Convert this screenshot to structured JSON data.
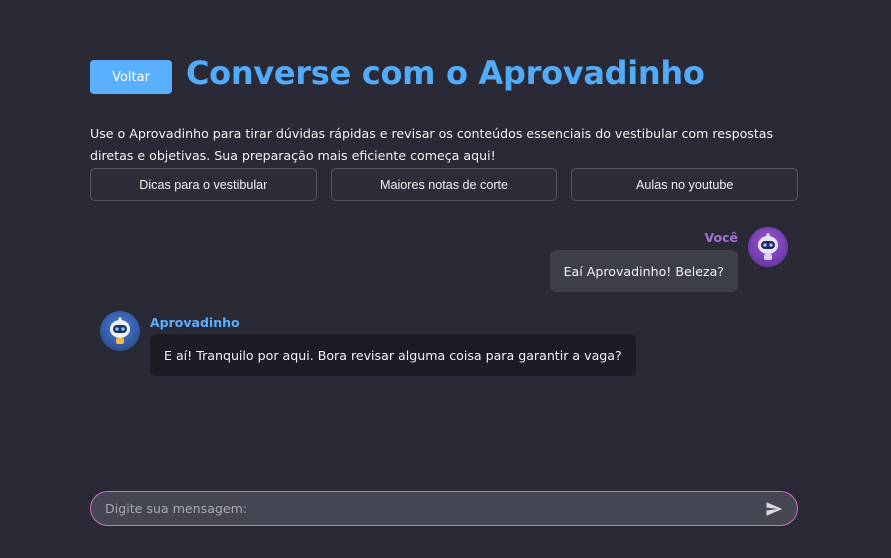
{
  "header": {
    "back_label": "Voltar",
    "title": "Converse com o Aprovadinho"
  },
  "intro": "Use o Aprovadinho para tirar dúvidas rápidas e revisar os conteúdos essenciais do vestibular com respostas diretas e objetivas. Sua preparação mais eficiente começa aqui!",
  "suggestions": [
    {
      "label": "Dicas para o vestibular"
    },
    {
      "label": "Maiores notas de corte"
    },
    {
      "label": "Aulas no youtube"
    }
  ],
  "messages": [
    {
      "sender": "Você",
      "text": "Eaí Aprovadinho! Beleza?",
      "avatar_icon": "robot-icon"
    },
    {
      "sender": "Aprovadinho",
      "text": "E aí! Tranquilo por aqui. Bora revisar alguma coisa para garantir a vaga?",
      "avatar_icon": "robot-icon"
    }
  ],
  "composer": {
    "placeholder": "Digite sua mensagem:",
    "value": "",
    "send_icon": "send-icon"
  },
  "colors": {
    "background": "#292a36",
    "accent_blue": "#52abf8",
    "user_name": "#a970d4",
    "input_border": "#d86ac7"
  }
}
